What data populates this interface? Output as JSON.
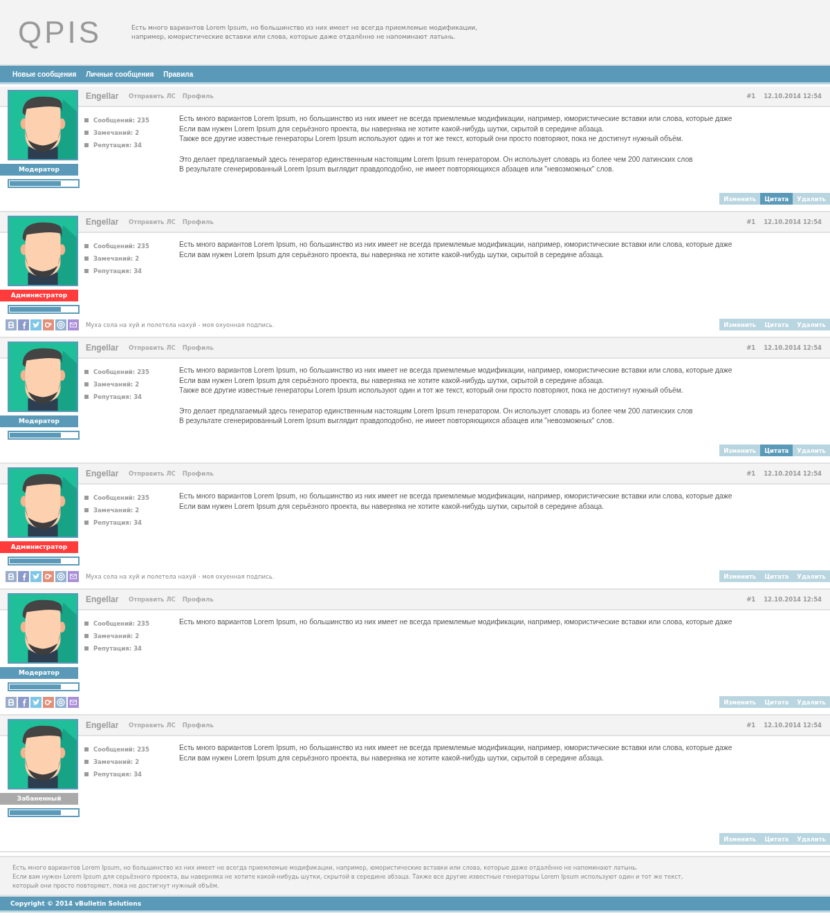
{
  "header": {
    "logo": "QPIS",
    "tagline": [
      "Есть много вариантов Lorem Ipsum, но большинство из них имеет не всегда приемлемые модификации,",
      "например, юмористические вставки или слова, которые даже отдалённо не напоминают латынь."
    ]
  },
  "nav": [
    "Новые сообщения",
    "Личные сообщения",
    "Правила"
  ],
  "posts": [
    {
      "author": "Engellar",
      "pm": "Отправить ЛС",
      "profile": "Профиль",
      "number": "#1",
      "date": "12.10.2014 12:54",
      "role": {
        "label": "Модератор",
        "color": "#5a9ab8"
      },
      "reputation": {
        "level": 0.75
      },
      "stats": [
        "Сообщений: 235",
        "Замечаний: 2",
        "Репутация: 34"
      ],
      "paragraphs": [
        [
          "Есть много вариантов Lorem Ipsum, но большинство из них имеет не всегда приемлемые модификации, например, юмористические вставки или слова, которые даже",
          "Если вам нужен Lorem Ipsum для серьёзного проекта, вы наверняка не хотите какой-нибудь шутки, скрытой в середине абзаца.",
          "Также все другие известные генераторы Lorem Ipsum используют один и тот же текст, который они просто повторяют, пока не достигнут нужный объём."
        ],
        [
          "Это делает предлагаемый здесь генератор единственным настоящим Lorem Ipsum генератором. Он использует словарь из более чем 200 латинских слов",
          "В результате сгенерированный Lorem Ipsum выглядит правдоподобно, не имеет повторяющихся абзацев или \"невозможных\" слов."
        ]
      ],
      "social": false,
      "actions": [
        {
          "label": "Изменить",
          "selected": false
        },
        {
          "label": "Цитата",
          "selected": true
        },
        {
          "label": "Удалить",
          "selected": false
        }
      ]
    },
    {
      "author": "Engellar",
      "pm": "Отправить ЛС",
      "profile": "Профиль",
      "number": "#1",
      "date": "12.10.2014 12:54",
      "role": {
        "label": "Администратор",
        "color": "#ff3b3b"
      },
      "reputation": {
        "level": 0.75
      },
      "stats": [
        "Сообщений: 235",
        "Замечаний: 2",
        "Репутация: 34"
      ],
      "paragraphs": [
        [
          "Есть много вариантов Lorem Ipsum, но большинство из них имеет не всегда приемлемые модификации, например, юмористические вставки или слова, которые даже",
          "Если вам нужен Lorem Ipsum для серьёзного проекта, вы наверняка не хотите какой-нибудь шутки, скрытой в середине абзаца."
        ]
      ],
      "social": true,
      "signature": "Муха села на хуй и полетела нахуй - моя охуенная подпись.",
      "actions": [
        {
          "label": "Изменить",
          "selected": false
        },
        {
          "label": "Цитата",
          "selected": false
        },
        {
          "label": "Удалить",
          "selected": false
        }
      ]
    },
    {
      "author": "Engellar",
      "pm": "Отправить ЛС",
      "profile": "Профиль",
      "number": "#1",
      "date": "12.10.2014 12:54",
      "role": {
        "label": "Модератор",
        "color": "#5a9ab8"
      },
      "reputation": {
        "level": 0.75
      },
      "stats": [
        "Сообщений: 235",
        "Замечаний: 2",
        "Репутация: 34"
      ],
      "paragraphs": [
        [
          "Есть много вариантов Lorem Ipsum, но большинство из них имеет не всегда приемлемые модификации, например, юмористические вставки или слова, которые даже",
          "Если вам нужен Lorem Ipsum для серьёзного проекта, вы наверняка не хотите какой-нибудь шутки, скрытой в середине абзаца.",
          "Также все другие известные генераторы Lorem Ipsum используют один и тот же текст, который они просто повторяют, пока не достигнут нужный объём."
        ],
        [
          "Это делает предлагаемый здесь генератор единственным настоящим Lorem Ipsum генератором. Он использует словарь из более чем 200 латинских слов",
          "В результате сгенерированный Lorem Ipsum выглядит правдоподобно, не имеет повторяющихся абзацев или \"невозможных\" слов."
        ]
      ],
      "social": false,
      "actions": [
        {
          "label": "Изменить",
          "selected": false
        },
        {
          "label": "Цитата",
          "selected": true
        },
        {
          "label": "Удалить",
          "selected": false
        }
      ]
    },
    {
      "author": "Engellar",
      "pm": "Отправить ЛС",
      "profile": "Профиль",
      "number": "#1",
      "date": "12.10.2014 12:54",
      "role": {
        "label": "Администратор",
        "color": "#ff3b3b"
      },
      "reputation": {
        "level": 0.75
      },
      "stats": [
        "Сообщений: 235",
        "Замечаний: 2",
        "Репутация: 34"
      ],
      "paragraphs": [
        [
          "Есть много вариантов Lorem Ipsum, но большинство из них имеет не всегда приемлемые модификации, например, юмористические вставки или слова, которые даже",
          "Если вам нужен Lorem Ipsum для серьёзного проекта, вы наверняка не хотите какой-нибудь шутки, скрытой в середине абзаца."
        ]
      ],
      "social": true,
      "signature": "Муха села на хуй и полетела нахуй - моя охуенная подпись.",
      "actions": [
        {
          "label": "Изменить",
          "selected": false
        },
        {
          "label": "Цитата",
          "selected": false
        },
        {
          "label": "Удалить",
          "selected": false
        }
      ]
    },
    {
      "author": "Engellar",
      "pm": "Отправить ЛС",
      "profile": "Профиль",
      "number": "#1",
      "date": "12.10.2014 12:54",
      "role": {
        "label": "Модератор",
        "color": "#5a9ab8"
      },
      "reputation": {
        "level": 0.75
      },
      "stats": [
        "Сообщений: 235",
        "Замечаний: 2",
        "Репутация: 34"
      ],
      "paragraphs": [
        [
          "Есть много вариантов Lorem Ipsum, но большинство из них имеет не всегда приемлемые модификации, например, юмористические вставки или слова, которые даже"
        ]
      ],
      "social": true,
      "actions": [
        {
          "label": "Изменить",
          "selected": false
        },
        {
          "label": "Цитата",
          "selected": false
        },
        {
          "label": "Удалить",
          "selected": false
        }
      ]
    },
    {
      "author": "Engellar",
      "pm": "Отправить ЛС",
      "profile": "Профиль",
      "number": "#1",
      "date": "12.10.2014 12:54",
      "role": {
        "label": "Забаненный",
        "color": "#aaaaaa"
      },
      "reputation": {
        "level": 0.75
      },
      "stats": [
        "Сообщений: 235",
        "Замечаний: 2",
        "Репутация: 34"
      ],
      "paragraphs": [
        [
          "Есть много вариантов Lorem Ipsum, но большинство из них имеет не всегда приемлемые модификации, например, юмористические вставки или слова, которые даже",
          "Если вам нужен Lorem Ipsum для серьёзного проекта, вы наверняка не хотите какой-нибудь шутки, скрытой в середине абзаца."
        ]
      ],
      "social": false,
      "actions": [
        {
          "label": "Изменить",
          "selected": false
        },
        {
          "label": "Цитата",
          "selected": false
        },
        {
          "label": "Удалить",
          "selected": false
        }
      ]
    }
  ],
  "footer": {
    "text": [
      "Есть много вариантов Lorem Ipsum, но большинство из них имеет не всегда приемлемые модификации, например, юмористические вставки или слова, которые даже отдалённо не напоминают латынь.",
      "Если вам нужен Lorem Ipsum для серьёзного проекта, вы наверняка не хотите какой-нибудь шутки, скрытой в середине абзаца. Также все другие известные генераторы Lorem Ipsum используют один и тот же текст,",
      "который они просто повторяют, пока не достигнут нужный объём."
    ],
    "copyright": "Copyright © 2014 vBulletin Solutions"
  }
}
